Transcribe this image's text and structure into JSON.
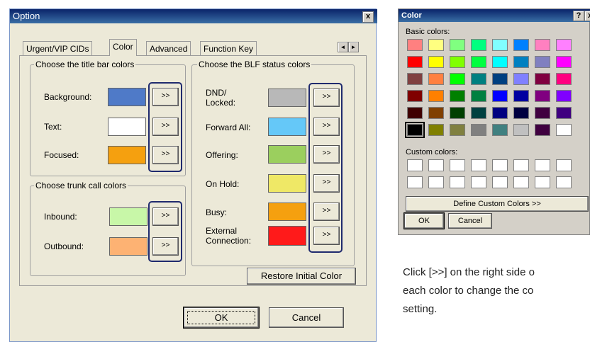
{
  "option_window": {
    "title": "Option",
    "close_label": "x",
    "tabs": [
      "Urgent/VIP CIDs",
      "Color",
      "Advanced",
      "Function Key"
    ],
    "scroll_left": "◄",
    "scroll_right": "►",
    "title_bar_group": {
      "title": "Choose the title bar colors",
      "items": [
        {
          "label": "Background:",
          "color": "#4f7ac8",
          "button": ">>"
        },
        {
          "label": "Text:",
          "color": "#ffffff",
          "button": ">>"
        },
        {
          "label": "Focused:",
          "color": "#f5a00f",
          "button": ">>"
        }
      ]
    },
    "trunk_group": {
      "title": "Choose trunk call colors",
      "items": [
        {
          "label": "Inbound:",
          "color": "#c8f7a8",
          "button": ">>"
        },
        {
          "label": "Outbound:",
          "color": "#fdb273",
          "button": ">>"
        }
      ]
    },
    "blf_group": {
      "title": "Choose the BLF status colors",
      "items": [
        {
          "label": "DND/\nLocked:",
          "color": "#b8b8b8",
          "button": ">>"
        },
        {
          "label": "Forward All:",
          "color": "#65c8f8",
          "button": ">>"
        },
        {
          "label": "Offering:",
          "color": "#9bcf5e",
          "button": ">>"
        },
        {
          "label": "On Hold:",
          "color": "#efe866",
          "button": ">>"
        },
        {
          "label": "Busy:",
          "color": "#f5a00f",
          "button": ">>"
        },
        {
          "label": "External\nConnection:",
          "color": "#ff1a1a",
          "button": ">>"
        }
      ]
    },
    "restore_label": "Restore Initial Color",
    "ok_label": "OK",
    "cancel_label": "Cancel"
  },
  "color_dialog": {
    "title": "Color",
    "help_label": "?",
    "close_label": "x",
    "basic_label": "Basic colors:",
    "basic_colors": [
      [
        "#ff8080",
        "#ffff80",
        "#80ff80",
        "#00ff80",
        "#80ffff",
        "#0080ff",
        "#ff80c0",
        "#ff80ff"
      ],
      [
        "#ff0000",
        "#ffff00",
        "#80ff00",
        "#00ff40",
        "#00ffff",
        "#0080c0",
        "#8080c0",
        "#ff00ff"
      ],
      [
        "#804040",
        "#ff8040",
        "#00ff00",
        "#008080",
        "#004080",
        "#8080ff",
        "#800040",
        "#ff0080"
      ],
      [
        "#800000",
        "#ff8000",
        "#008000",
        "#008040",
        "#0000ff",
        "#0000a0",
        "#800080",
        "#8000ff"
      ],
      [
        "#400000",
        "#804000",
        "#004000",
        "#004040",
        "#000080",
        "#000040",
        "#400040",
        "#400080"
      ],
      [
        "#000000",
        "#808000",
        "#808040",
        "#808080",
        "#408080",
        "#c0c0c0",
        "#400040",
        "#ffffff"
      ]
    ],
    "custom_label": "Custom colors:",
    "custom_colors": [
      [
        "#ffffff",
        "#ffffff",
        "#ffffff",
        "#ffffff",
        "#ffffff",
        "#ffffff",
        "#ffffff",
        "#ffffff"
      ],
      [
        "#ffffff",
        "#ffffff",
        "#ffffff",
        "#ffffff",
        "#ffffff",
        "#ffffff",
        "#ffffff",
        "#ffffff"
      ]
    ],
    "define_label": "Define Custom Colors >>",
    "ok_label": "OK",
    "cancel_label": "Cancel"
  },
  "instruction": "Click [>>] on the right side of each color to change the color setting.",
  "instruction_lines": [
    "Click [>>] on the right side o",
    "each color to change the co",
    "setting."
  ]
}
